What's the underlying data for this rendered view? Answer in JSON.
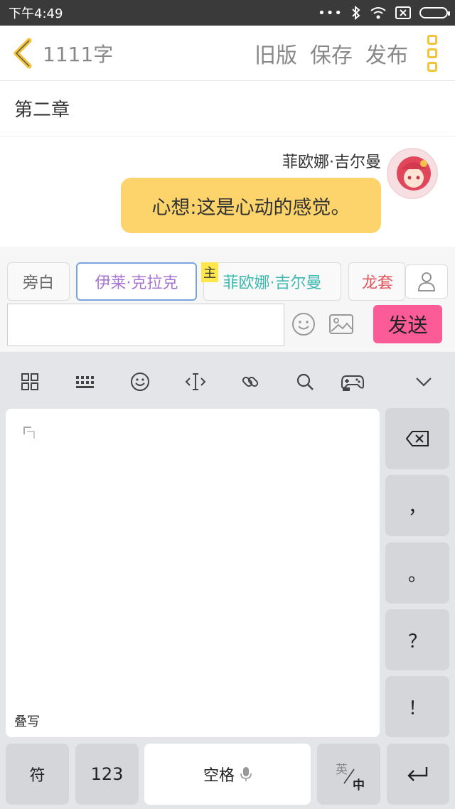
{
  "status_bar": {
    "time": "下午4:49",
    "more": "•••"
  },
  "header": {
    "word_count": "1111字",
    "actions": [
      "旧版",
      "保存",
      "发布"
    ]
  },
  "chapter": {
    "title": "第二章"
  },
  "chat": {
    "speaker": "菲欧娜·吉尔曼",
    "message": "心想:这是心动的感觉。"
  },
  "characters": {
    "narrator": "旁白",
    "items": [
      {
        "label": "伊莱·克拉克",
        "color": "#a774d2"
      },
      {
        "label": "菲欧娜·吉尔曼",
        "color": "#3cb8b0"
      },
      {
        "label": "龙套",
        "color": "#e0555b"
      }
    ],
    "main_tag": "主"
  },
  "input": {
    "value": "",
    "send_label": "发送"
  },
  "keyboard": {
    "pad_label": "叠写",
    "side_keys": [
      "，",
      "。",
      "？",
      "！"
    ],
    "bottom": {
      "symbols": "符",
      "numbers": "123",
      "space": "空格",
      "lang_top": "英",
      "lang_bottom": "中"
    }
  },
  "colors": {
    "accent_yellow": "#f3c33a",
    "bubble": "#fcd46b",
    "send": "#fb5b96"
  }
}
